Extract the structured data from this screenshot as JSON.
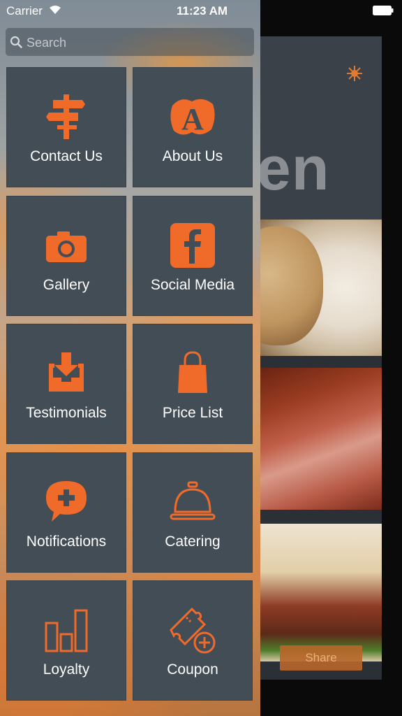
{
  "status_bar": {
    "carrier": "Carrier",
    "time": "11:23 AM"
  },
  "search": {
    "placeholder": "Search",
    "value": ""
  },
  "menu": {
    "items": [
      {
        "label": "Contact Us",
        "icon": "signpost-icon"
      },
      {
        "label": "About Us",
        "icon": "letter-a-icon"
      },
      {
        "label": "Gallery",
        "icon": "camera-icon"
      },
      {
        "label": "Social Media",
        "icon": "facebook-icon"
      },
      {
        "label": "Testimonials",
        "icon": "inbox-download-icon"
      },
      {
        "label": "Price List",
        "icon": "shopping-bag-icon"
      },
      {
        "label": "Notifications",
        "icon": "chat-plus-icon"
      },
      {
        "label": "Catering",
        "icon": "cloche-icon"
      },
      {
        "label": "Loyalty",
        "icon": "bar-chart-icon"
      },
      {
        "label": "Coupon",
        "icon": "ticket-plus-icon"
      }
    ]
  },
  "background_app": {
    "title_fragment": "hen",
    "share_label": "Share"
  },
  "colors": {
    "accent": "#f06a2a",
    "tile": "#434d56",
    "share": "#b8672a"
  }
}
